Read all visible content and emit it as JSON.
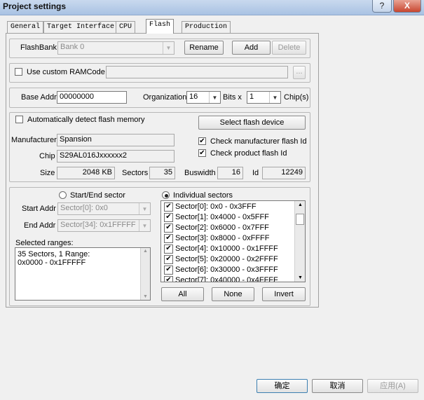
{
  "window": {
    "title": "Project settings",
    "help_label": "?",
    "close_label": "X"
  },
  "tabs": [
    "General",
    "Target Interface",
    "CPU",
    "Flash",
    "Production"
  ],
  "flashbank": {
    "label": "FlashBank",
    "value": "Bank 0",
    "rename": "Rename",
    "add": "Add",
    "delete": "Delete"
  },
  "ramcode": {
    "label": "Use custom RAMCode",
    "value": "",
    "browse": "..."
  },
  "base": {
    "label": "Base Addr",
    "value": "00000000",
    "org_label": "Organization",
    "org_value": "16",
    "bits_label": "Bits x",
    "chips_value": "1",
    "chips_label": "Chip(s)"
  },
  "detect": {
    "label": "Automatically detect flash memory",
    "select_button": "Select flash device"
  },
  "device": {
    "manufacturer_label": "Manufacturer",
    "manufacturer": "Spansion",
    "chip_label": "Chip",
    "chip": "S29AL016Jxxxxxx2",
    "check_mfr": "Check manufacturer flash Id",
    "check_prod": "Check product flash Id",
    "size_label": "Size",
    "size": "2048 KB",
    "sectors_label": "Sectors",
    "sectors": "35",
    "buswidth_label": "Buswidth",
    "buswidth": "16",
    "id_label": "Id",
    "id": "12249"
  },
  "range": {
    "start_end_label": "Start/End sector",
    "individual_label": "Individual sectors",
    "start_label": "Start Addr",
    "start_value": "Sector[0]: 0x0",
    "end_label": "End Addr",
    "end_value": "Sector[34]: 0x1FFFFF",
    "selected_label": "Selected ranges:",
    "selected_lines": [
      "35 Sectors, 1 Range:",
      "0x0000 - 0x1FFFFF"
    ],
    "sectors": [
      "Sector[0]: 0x0 - 0x3FFF",
      "Sector[1]: 0x4000 - 0x5FFF",
      "Sector[2]: 0x6000 - 0x7FFF",
      "Sector[3]: 0x8000 - 0xFFFF",
      "Sector[4]: 0x10000 - 0x1FFFF",
      "Sector[5]: 0x20000 - 0x2FFFF",
      "Sector[6]: 0x30000 - 0x3FFFF",
      "Sector[7]: 0x40000 - 0x4FFFF"
    ],
    "all": "All",
    "none": "None",
    "invert": "Invert"
  },
  "footer": {
    "ok": "确定",
    "cancel": "取消",
    "apply": "应用(A)"
  }
}
